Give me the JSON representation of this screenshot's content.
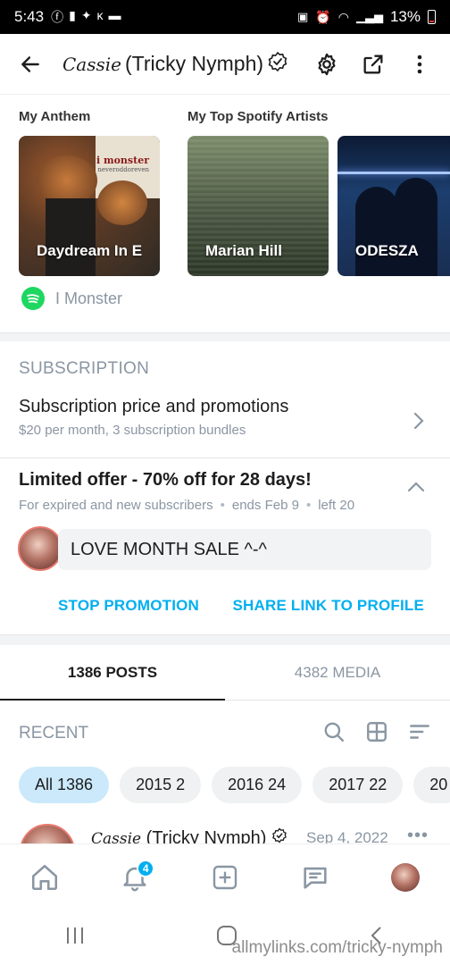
{
  "status_bar": {
    "time": "5:43",
    "battery": "13%"
  },
  "header": {
    "script_name": "Cassie",
    "title": "(Tricky Nymph)",
    "icons": [
      "back-arrow-icon",
      "verified-icon",
      "gear-icon",
      "share-icon",
      "more-vertical-icon"
    ]
  },
  "anthem": {
    "my_anthem_label": "My Anthem",
    "top_artists_label": "My Top Spotify Artists",
    "anthem_card": {
      "title": "Daydream In E",
      "album_artist": "i monster",
      "album_subtitle": "neveroddoreven"
    },
    "artists": [
      "Marian Hill",
      "ODESZA"
    ],
    "spotify_artist": "I Monster"
  },
  "subscription": {
    "header": "SUBSCRIPTION",
    "title": "Subscription price and promotions",
    "desc": "$20 per month, 3 subscription bundles"
  },
  "offer": {
    "title": "Limited offer - 70% off for 28 days!",
    "audience": "For expired and new subscribers",
    "ends": "ends Feb 9",
    "left": "left 20",
    "message": "LOVE MONTH SALE ^-^",
    "stop_label": "STOP PROMOTION",
    "share_label": "SHARE LINK TO PROFILE"
  },
  "tabs": {
    "posts": "1386 POSTS",
    "media": "4382 MEDIA"
  },
  "recent": {
    "label": "RECENT",
    "chips": [
      "All 1386",
      "2015 2",
      "2016 24",
      "2017 22",
      "20"
    ]
  },
  "post": {
    "script_name": "Cassie",
    "author": "(Tricky Nymph)",
    "date": "Sep 4, 2022",
    "more": "•••"
  },
  "bottom_nav": {
    "notification_count": "4"
  },
  "watermark": "allmylinks.com/tricky-nymph",
  "colors": {
    "accent": "#00aff0",
    "muted": "#8a96a3",
    "spotify": "#1ed760",
    "chip_active": "#cbe9fa"
  }
}
